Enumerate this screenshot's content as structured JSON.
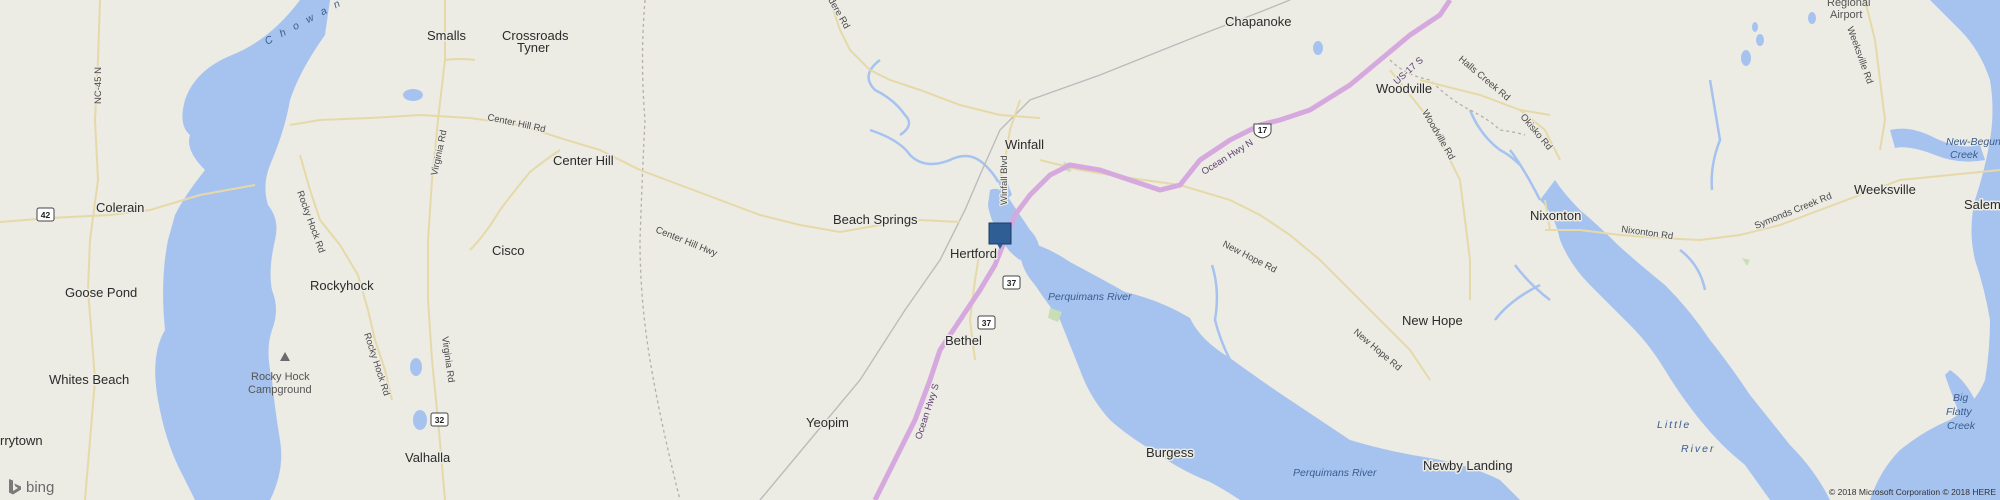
{
  "map": {
    "places": [
      {
        "name": "Smalls",
        "kind": "place"
      },
      {
        "name": "Crossroads",
        "kind": "place"
      },
      {
        "name": "Tyner",
        "kind": "place"
      },
      {
        "name": "Chapanoke",
        "kind": "place"
      },
      {
        "name": "Woodville",
        "kind": "place"
      },
      {
        "name": "Winfall",
        "kind": "place"
      },
      {
        "name": "Center Hill",
        "kind": "place"
      },
      {
        "name": "Colerain",
        "kind": "place"
      },
      {
        "name": "Beach Springs",
        "kind": "place"
      },
      {
        "name": "Hertford",
        "kind": "place"
      },
      {
        "name": "Cisco",
        "kind": "place"
      },
      {
        "name": "Nixonton",
        "kind": "place"
      },
      {
        "name": "Weeksville",
        "kind": "place"
      },
      {
        "name": "Salem",
        "kind": "place"
      },
      {
        "name": "Goose Pond",
        "kind": "place"
      },
      {
        "name": "Rockyhock",
        "kind": "place"
      },
      {
        "name": "New Hope",
        "kind": "place"
      },
      {
        "name": "Bethel",
        "kind": "place"
      },
      {
        "name": "Whites Beach",
        "kind": "place"
      },
      {
        "name": "Yeopim",
        "kind": "place"
      },
      {
        "name": "rrytown",
        "kind": "place"
      },
      {
        "name": "Valhalla",
        "kind": "place"
      },
      {
        "name": "Burgess",
        "kind": "place"
      },
      {
        "name": "Newby Landing",
        "kind": "place"
      }
    ],
    "poi": {
      "rocky_hock_1": "Rocky Hock",
      "rocky_hock_2": "Campground",
      "airport_1": "Regional",
      "airport_2": "Airport"
    },
    "roads": {
      "center_hill_rd": "Center Hill Rd",
      "center_hill_hwy": "Center Hill Hwy",
      "virginia_rd": "Virginia Rd",
      "virginia_rd_2": "Virginia Rd",
      "rocky_hock_rd": "Rocky Hock Rd",
      "rocky_hock_rd_2": "Rocky Hock Rd",
      "nc45n": "NC-45 N",
      "winfall_blvd": "Winfall Blvd",
      "ocean_hwy_n": "Ocean Hwy N",
      "ocean_hwy_s": "Ocean Hwy S",
      "us17s": "US-17 S",
      "halls_creek_rd": "Halls Creek Rd",
      "woodville_rd": "Woodville Rd",
      "okisko_rd": "Okisko Rd",
      "nixonton_rd": "Nixonton Rd",
      "symonds_creek_rd": "Symonds Creek Rd",
      "weeksville_rd": "Weeksville Rd",
      "new_hope_rd": "New Hope Rd",
      "new_hope_rd_2": "New Hope Rd",
      "belvidere_rd": "dere Rd"
    },
    "water": {
      "chowan": "Chowan",
      "perquimans_1": "Perquimans River",
      "perquimans_2": "Perquimans River",
      "little_river_1": "Little",
      "little_river_2": "River",
      "new_begun_1": "New-Begun",
      "new_begun_2": "Creek",
      "big_flatty_1": "Big",
      "big_flatty_2": "Flatty",
      "big_flatty_3": "Creek"
    },
    "shields": {
      "nc42": "42",
      "nc37a": "37",
      "nc37b": "37",
      "nc32": "32",
      "us17": "17"
    },
    "brand": "bing",
    "copyright": "© 2018 Microsoft Corporation © 2018 HERE"
  },
  "colors": {
    "land": "#ecebe4",
    "water": "#a6c3ef",
    "highway": "#d6a9de",
    "road": "#e6d9a8",
    "boundary": "#b4b0a8",
    "pin": "#2e5e94"
  }
}
